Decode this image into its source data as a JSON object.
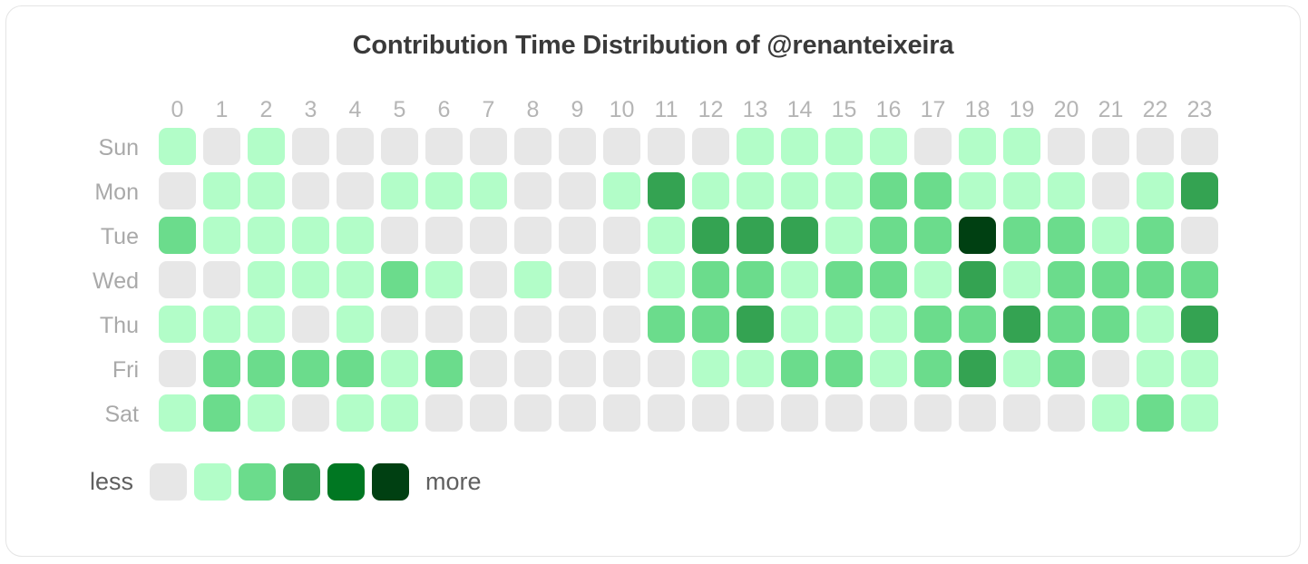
{
  "header": {
    "title": "Contribution Time Distribution of @renanteixeira"
  },
  "legend": {
    "less_label": "less",
    "more_label": "more",
    "colors": [
      "#e7e7e7",
      "#b2fdc8",
      "#6bdc8c",
      "#34a352",
      "#007722",
      "#004012"
    ]
  },
  "chart_data": {
    "type": "heatmap",
    "title": "Contribution Time Distribution of @renanteixeira",
    "xlabel": "",
    "ylabel": "",
    "x": [
      "0",
      "1",
      "2",
      "3",
      "4",
      "5",
      "6",
      "7",
      "8",
      "9",
      "10",
      "11",
      "12",
      "13",
      "14",
      "15",
      "16",
      "17",
      "18",
      "19",
      "20",
      "21",
      "22",
      "23"
    ],
    "y": [
      "Sun",
      "Mon",
      "Tue",
      "Wed",
      "Thu",
      "Fri",
      "Sat"
    ],
    "levels": [
      0,
      1,
      2,
      3,
      4,
      5
    ],
    "level_colors": [
      "#e7e7e7",
      "#b2fdc8",
      "#6bdc8c",
      "#34a352",
      "#007722",
      "#004012"
    ],
    "legend_position": "bottom-left",
    "grid": false,
    "rows": [
      {
        "day": "Sun",
        "values": [
          1,
          0,
          1,
          0,
          0,
          0,
          0,
          0,
          0,
          0,
          0,
          0,
          0,
          1,
          1,
          1,
          1,
          0,
          1,
          1,
          0,
          0,
          0,
          0
        ]
      },
      {
        "day": "Mon",
        "values": [
          0,
          1,
          1,
          0,
          0,
          1,
          1,
          1,
          0,
          0,
          1,
          3,
          1,
          1,
          1,
          1,
          2,
          2,
          1,
          1,
          1,
          0,
          1,
          3
        ]
      },
      {
        "day": "Tue",
        "values": [
          2,
          1,
          1,
          1,
          1,
          0,
          0,
          0,
          0,
          0,
          0,
          1,
          3,
          3,
          3,
          1,
          2,
          2,
          5,
          2,
          2,
          1,
          2,
          0
        ]
      },
      {
        "day": "Wed",
        "values": [
          0,
          0,
          1,
          1,
          1,
          2,
          1,
          0,
          1,
          0,
          0,
          1,
          2,
          2,
          1,
          2,
          2,
          1,
          3,
          1,
          2,
          2,
          2,
          2
        ]
      },
      {
        "day": "Thu",
        "values": [
          1,
          1,
          1,
          0,
          1,
          0,
          0,
          0,
          0,
          0,
          0,
          2,
          2,
          3,
          1,
          1,
          1,
          2,
          2,
          3,
          2,
          2,
          1,
          3
        ]
      },
      {
        "day": "Fri",
        "values": [
          0,
          2,
          2,
          2,
          2,
          1,
          2,
          0,
          0,
          0,
          0,
          0,
          1,
          1,
          2,
          2,
          1,
          2,
          3,
          1,
          2,
          0,
          1,
          1
        ]
      },
      {
        "day": "Sat",
        "values": [
          1,
          2,
          1,
          0,
          1,
          1,
          0,
          0,
          0,
          0,
          0,
          0,
          0,
          0,
          0,
          0,
          0,
          0,
          0,
          0,
          0,
          1,
          2,
          1
        ]
      }
    ]
  }
}
